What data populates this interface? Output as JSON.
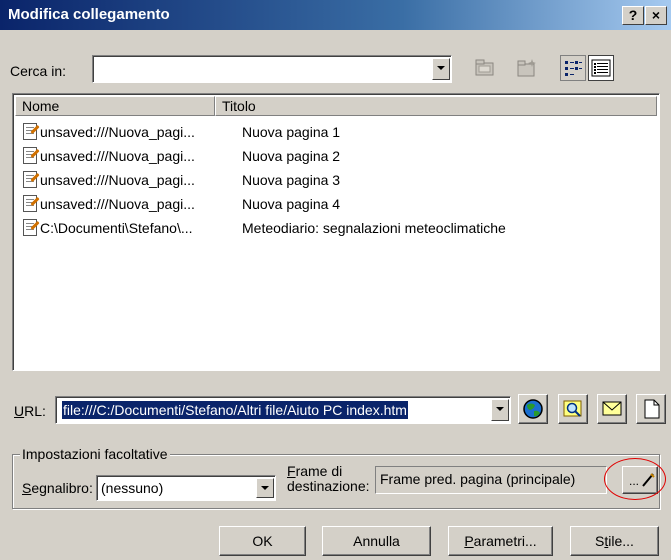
{
  "window": {
    "title": "Modifica collegamento",
    "help_btn": "?",
    "close_btn": "×"
  },
  "lookin": {
    "label": "Cerca in:",
    "value": ""
  },
  "list": {
    "col_name": "Nome",
    "col_title": "Titolo",
    "rows": [
      {
        "name": "unsaved:///Nuova_pagi...",
        "title": "Nuova pagina 1"
      },
      {
        "name": "unsaved:///Nuova_pagi...",
        "title": "Nuova pagina 2"
      },
      {
        "name": "unsaved:///Nuova_pagi...",
        "title": "Nuova pagina 3"
      },
      {
        "name": "unsaved:///Nuova_pagi...",
        "title": "Nuova pagina 4"
      },
      {
        "name": "C:\\Documenti\\Stefano\\...",
        "title": "Meteodiario: segnalazioni meteoclimatiche"
      }
    ]
  },
  "url": {
    "label_u": "U",
    "label_rest": "RL:",
    "value": "file:///C:/Documenti/Stefano/Altri file/Aiuto PC index.htm"
  },
  "options": {
    "group_label": "Impostazioni facoltative",
    "bookmark_label_u": "S",
    "bookmark_label_rest": "egnalibro:",
    "bookmark_value": "(nessuno)",
    "frame_label_line1_u": "F",
    "frame_label_line1_rest": "rame di",
    "frame_label_line2": "destinazione:",
    "frame_value": "Frame pred. pagina (principale)",
    "frame_btn": "..."
  },
  "buttons": {
    "ok": "OK",
    "cancel": "Annulla",
    "params_u": "P",
    "params_rest": "arametri...",
    "style_pre": "S",
    "style_u": "t",
    "style_rest": "ile..."
  },
  "colors": {
    "selection": "#0a246a",
    "highlight_circle": "#e00000"
  }
}
